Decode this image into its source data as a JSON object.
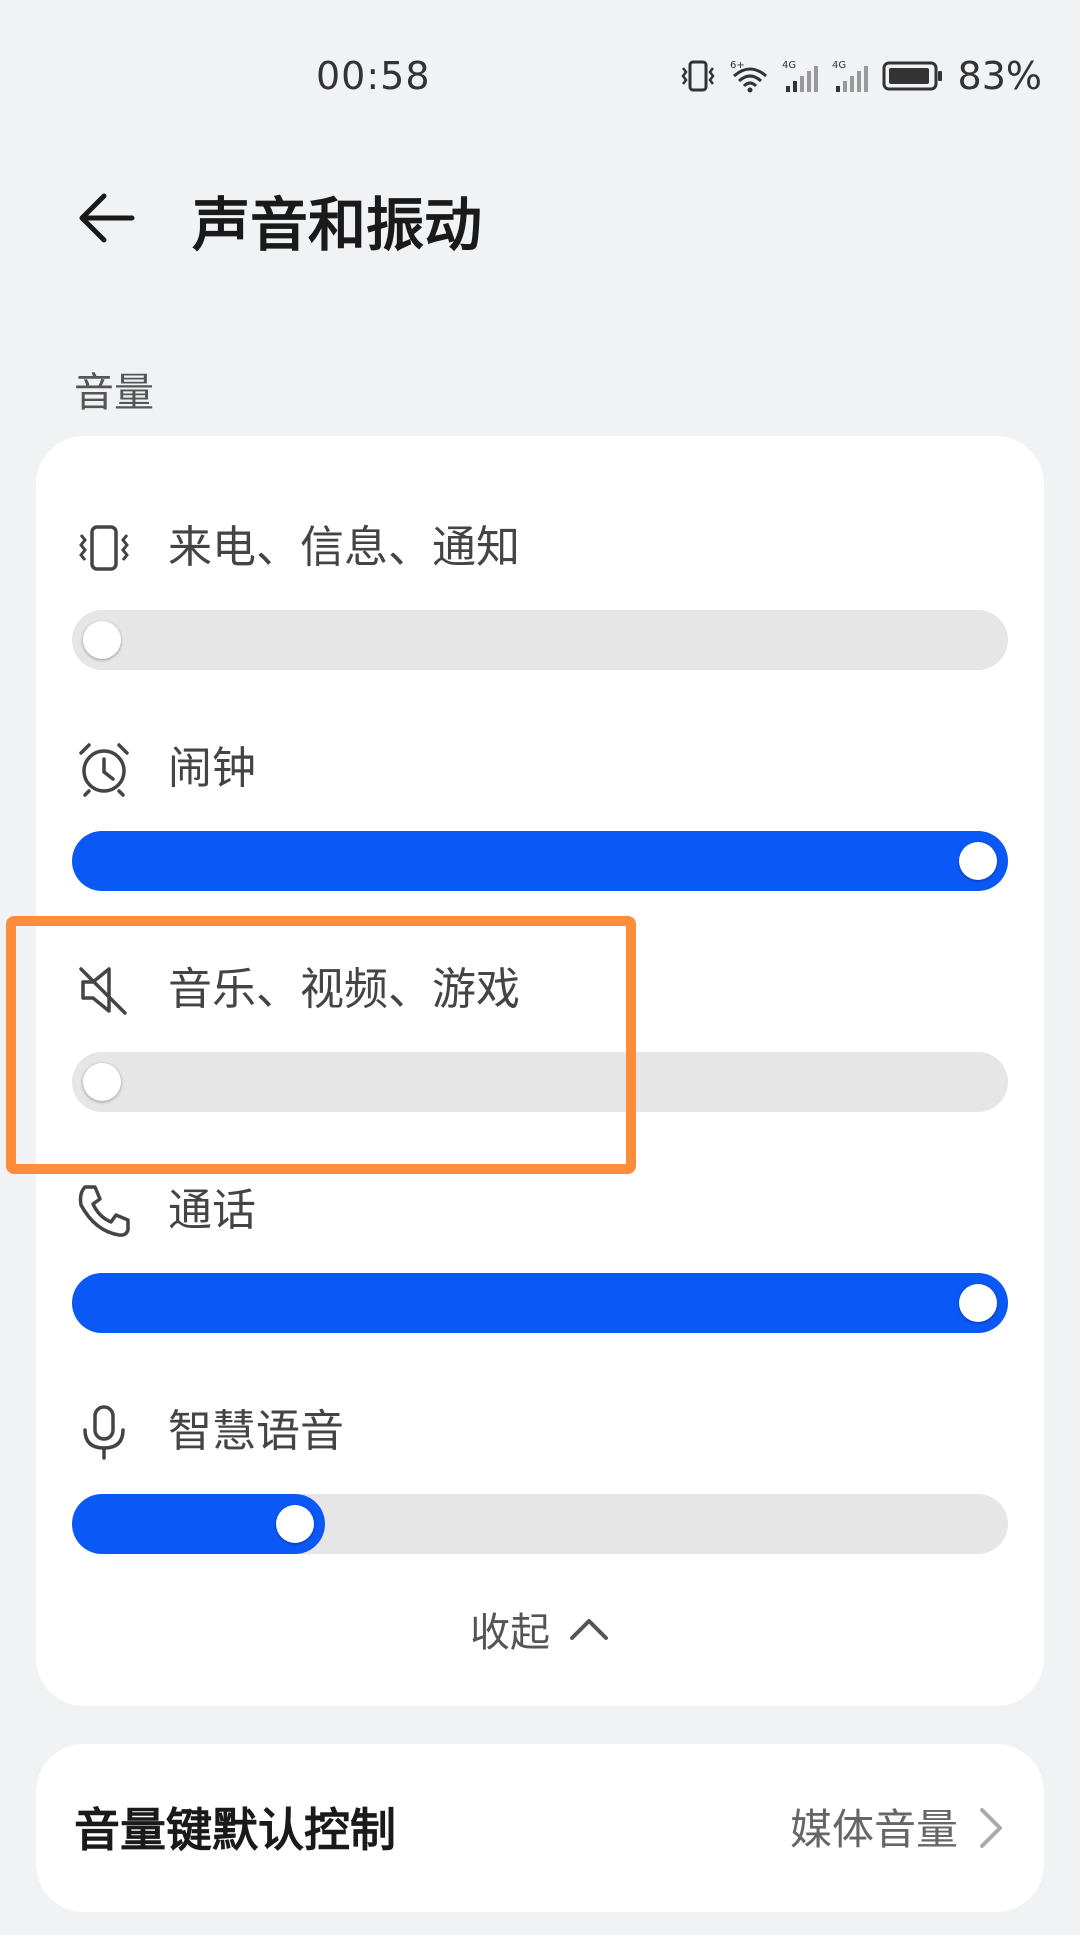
{
  "status_bar": {
    "time": "00:58",
    "battery_percent": "83%",
    "network_1": "4G",
    "network_2": "4G",
    "wifi_badge": "6+"
  },
  "header": {
    "title": "声音和振动"
  },
  "volume_section": {
    "title": "音量",
    "items": [
      {
        "label": "来电、信息、通知",
        "icon": "vibrate-icon",
        "level": 0.0
      },
      {
        "label": "闹钟",
        "icon": "alarm-clock-icon",
        "level": 1.0
      },
      {
        "label": "音乐、视频、游戏",
        "icon": "speaker-muted-icon",
        "level": 0.0
      },
      {
        "label": "通话",
        "icon": "phone-icon",
        "level": 1.0
      },
      {
        "label": "智慧语音",
        "icon": "microphone-icon",
        "level": 0.22
      }
    ],
    "collapse_label": "收起"
  },
  "volume_key": {
    "label": "音量键默认控制",
    "value": "媒体音量"
  },
  "colors": {
    "accent": "#0a59f7",
    "track": "#e6e6e6",
    "highlight": "#ff8c3a",
    "background": "#f1f2f4"
  }
}
